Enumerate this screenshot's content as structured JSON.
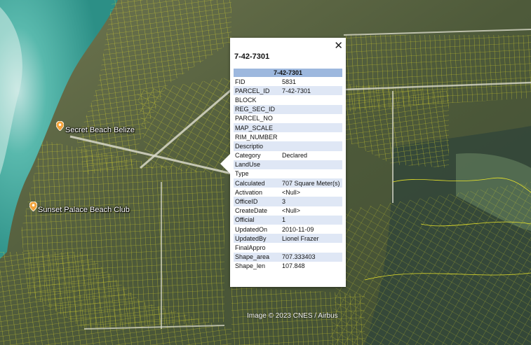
{
  "popup": {
    "title": "7-42-7301",
    "close_glyph": "✕",
    "header": "7-42-7301",
    "rows": [
      {
        "key": "FID",
        "value": "5831"
      },
      {
        "key": "PARCEL_ID",
        "value": "7-42-7301"
      },
      {
        "key": "BLOCK",
        "value": ""
      },
      {
        "key": "REG_SEC_ID",
        "value": ""
      },
      {
        "key": "PARCEL_NO",
        "value": ""
      },
      {
        "key": "MAP_SCALE",
        "value": ""
      },
      {
        "key": "RIM_NUMBER",
        "value": ""
      },
      {
        "key": "Descriptio",
        "value": ""
      },
      {
        "key": "Category",
        "value": "Declared"
      },
      {
        "key": "LandUse",
        "value": ""
      },
      {
        "key": "Type",
        "value": ""
      },
      {
        "key": "Calculated",
        "value": "707 Square Meter(s)"
      },
      {
        "key": "Activation",
        "value": "<Null>"
      },
      {
        "key": "OfficeID",
        "value": "3"
      },
      {
        "key": "CreateDate",
        "value": "<Null>"
      },
      {
        "key": "Official",
        "value": "1"
      },
      {
        "key": "UpdatedOn",
        "value": "2010-11-09"
      },
      {
        "key": "UpdatedBy",
        "value": "Lionel Frazer"
      },
      {
        "key": "FinalAppro",
        "value": ""
      },
      {
        "key": "Shape_area",
        "value": "707.333403"
      },
      {
        "key": "Shape_len",
        "value": "107.848"
      }
    ]
  },
  "places": [
    {
      "name": "Secret Beach Belize",
      "icon": "map-pin-icon"
    },
    {
      "name": "Sunset Palace Beach Club",
      "icon": "map-pin-icon"
    }
  ],
  "attribution": "Image © 2023 CNES / Airbus",
  "colors": {
    "parcel_lines": "#e6e22a",
    "sea": "#35a99c",
    "vegetation": "#4d5a3b",
    "popup_header": "#9db8de",
    "popup_alt_row": "#dfe7f5",
    "pin": "#f2a33a"
  }
}
